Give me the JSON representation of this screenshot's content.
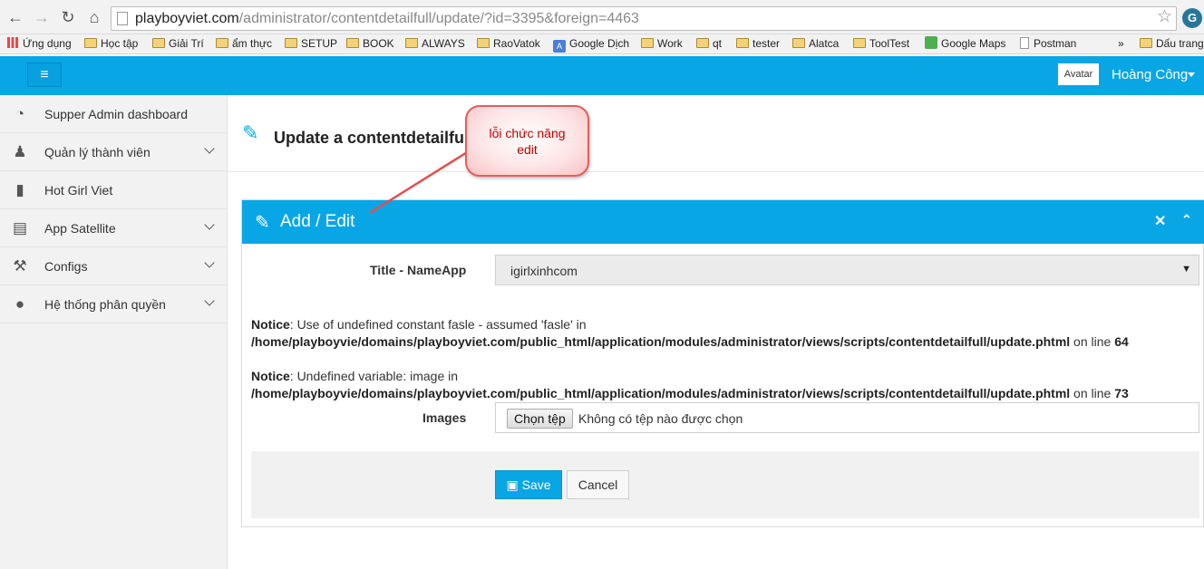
{
  "browser": {
    "url_host": "playboyviet.com",
    "url_path": "/administrator/contentdetailfull/update/?id=3395&foreign=4463",
    "bookmarks": [
      {
        "label": "Ứng dụng",
        "icon": "apps-icon"
      },
      {
        "label": "Học tập",
        "icon": "folder-icon"
      },
      {
        "label": "Giải Trí",
        "icon": "folder-icon"
      },
      {
        "label": "ẩm thực",
        "icon": "folder-icon"
      },
      {
        "label": "SETUP",
        "icon": "folder-icon"
      },
      {
        "label": "BOOK",
        "icon": "folder-icon"
      },
      {
        "label": "ALWAYS",
        "icon": "folder-icon"
      },
      {
        "label": "RaoVatok",
        "icon": "folder-icon"
      },
      {
        "label": "Google Dịch",
        "icon": "google-translate-icon"
      },
      {
        "label": "Work",
        "icon": "folder-icon"
      },
      {
        "label": "qt",
        "icon": "folder-icon"
      },
      {
        "label": "tester",
        "icon": "folder-icon"
      },
      {
        "label": "Alatca",
        "icon": "folder-icon"
      },
      {
        "label": "ToolTest",
        "icon": "folder-icon"
      },
      {
        "label": "Google Maps",
        "icon": "google-maps-icon"
      },
      {
        "label": "Postman",
        "icon": "page-icon"
      }
    ],
    "more_bookmarks": "»",
    "other_bookmarks": "Dấu trang"
  },
  "header": {
    "menu_icon": "≡",
    "avatar_label": "Avatar",
    "user_name": "Hoàng Công"
  },
  "sidebar": {
    "items": [
      {
        "label": "Supper Admin dashboard",
        "icon": "dashboard-icon",
        "glyph": "◔",
        "expandable": false
      },
      {
        "label": "Quản lý thành viên",
        "icon": "user-icon",
        "glyph": "♟",
        "expandable": true
      },
      {
        "label": "Hot Girl Viet",
        "icon": "file-icon",
        "glyph": "▮",
        "expandable": false
      },
      {
        "label": "App Satellite",
        "icon": "file-text-icon",
        "glyph": "▤",
        "expandable": true
      },
      {
        "label": "Configs",
        "icon": "wrench-icon",
        "glyph": "⚒",
        "expandable": true
      },
      {
        "label": "Hệ thống phân quyền",
        "icon": "user-group-icon",
        "glyph": "●",
        "expandable": true
      }
    ]
  },
  "page": {
    "title": "Update a contentdetailfu",
    "panel_title": "Add / Edit",
    "title_field_label": "Title - NameApp",
    "title_field_value": "igirlxinhcom",
    "notices": [
      {
        "prefix": "Notice",
        "message": ": Use of undefined constant fasle - assumed 'fasle' in",
        "path": "/home/playboyvie/domains/playboyviet.com/public_html/application/modules/administrator/views/scripts/contentdetailfull/update.phtml",
        "line_text": " on line ",
        "line": "64"
      },
      {
        "prefix": "Notice",
        "message": ": Undefined variable: image in",
        "path": "/home/playboyvie/domains/playboyviet.com/public_html/application/modules/administrator/views/scripts/contentdetailfull/update.phtml",
        "line_text": " on line ",
        "line": "73"
      }
    ],
    "images_label": "Images",
    "file_button": "Chọn tệp",
    "file_status": "Không có tệp nào được chọn",
    "save_label": "Save",
    "cancel_label": "Cancel"
  },
  "annotation": {
    "line1": "lỗi chức năng",
    "line2": "edit"
  }
}
